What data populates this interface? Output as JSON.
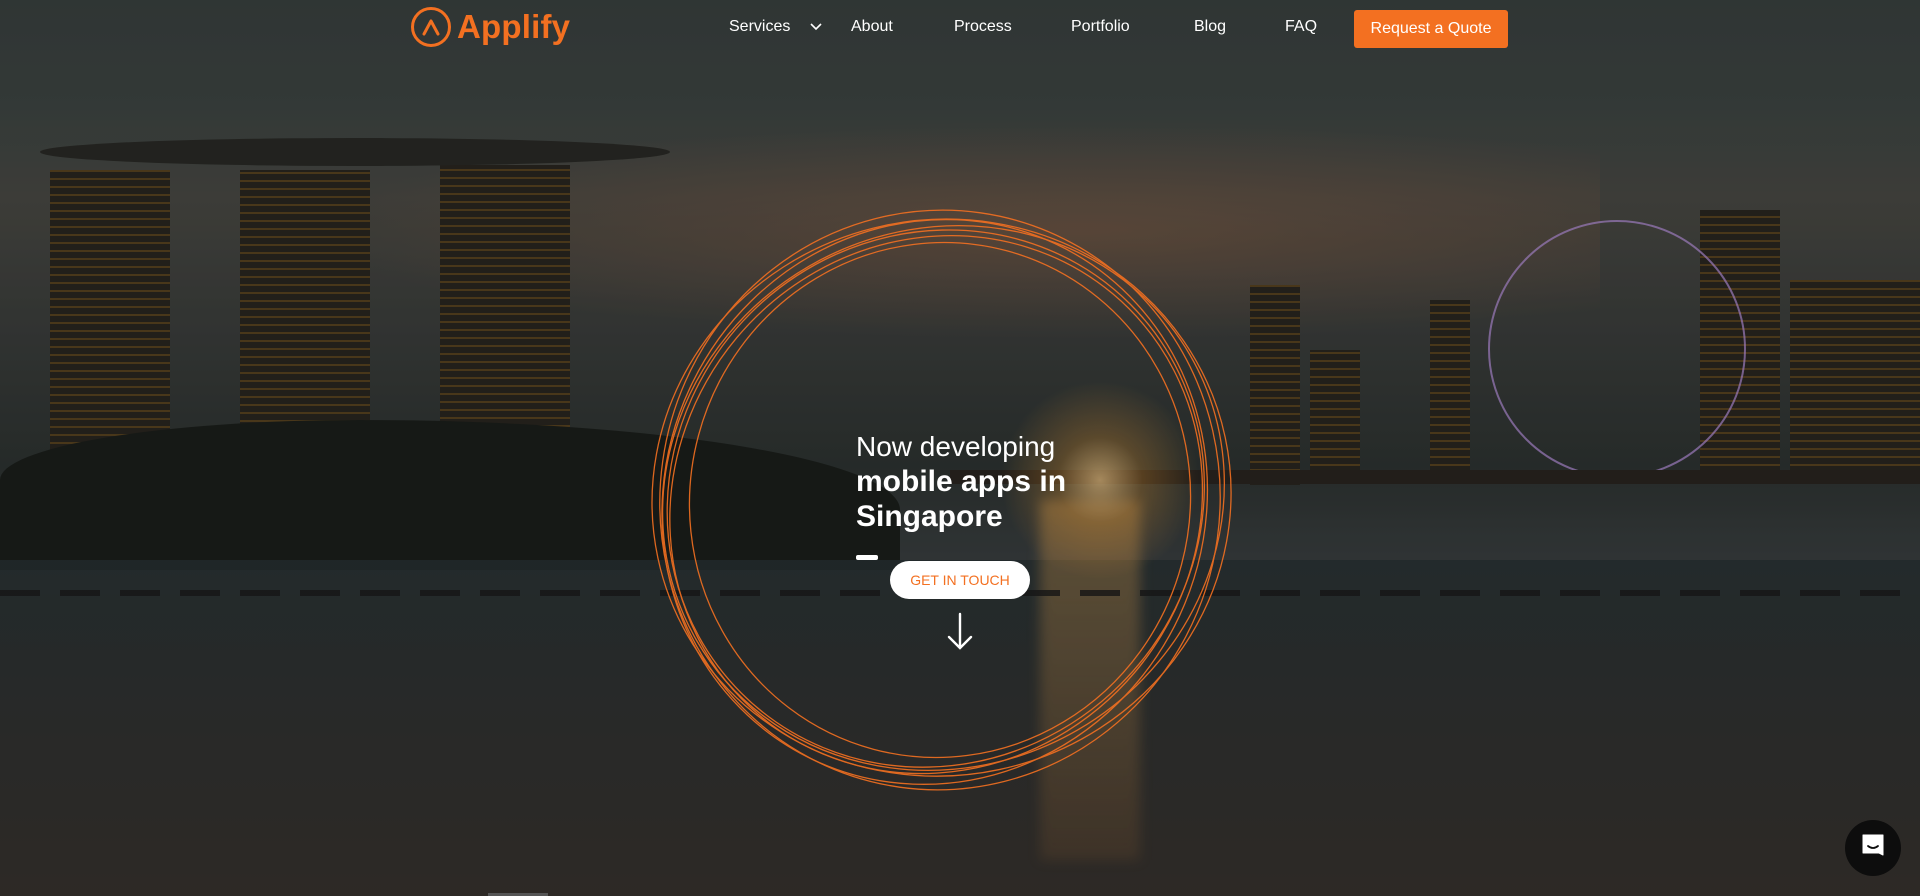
{
  "header": {
    "logo_text": "Applify",
    "nav": [
      {
        "label": "Services",
        "has_dropdown": true
      },
      {
        "label": "About"
      },
      {
        "label": "Process"
      },
      {
        "label": "Portfolio"
      },
      {
        "label": "Blog"
      },
      {
        "label": "FAQ"
      }
    ],
    "cta_label": "Request a Quote"
  },
  "hero": {
    "line1": "Now developing",
    "line2": "mobile apps in",
    "line3": "Singapore",
    "button_label": "GET IN TOUCH",
    "scroll_icon": "arrow-down-icon"
  },
  "chat_widget": {
    "icon": "chat-bubble-icon"
  },
  "colors": {
    "accent": "#f37021",
    "text": "#ffffff",
    "chat_bg": "#0d0d0d"
  }
}
